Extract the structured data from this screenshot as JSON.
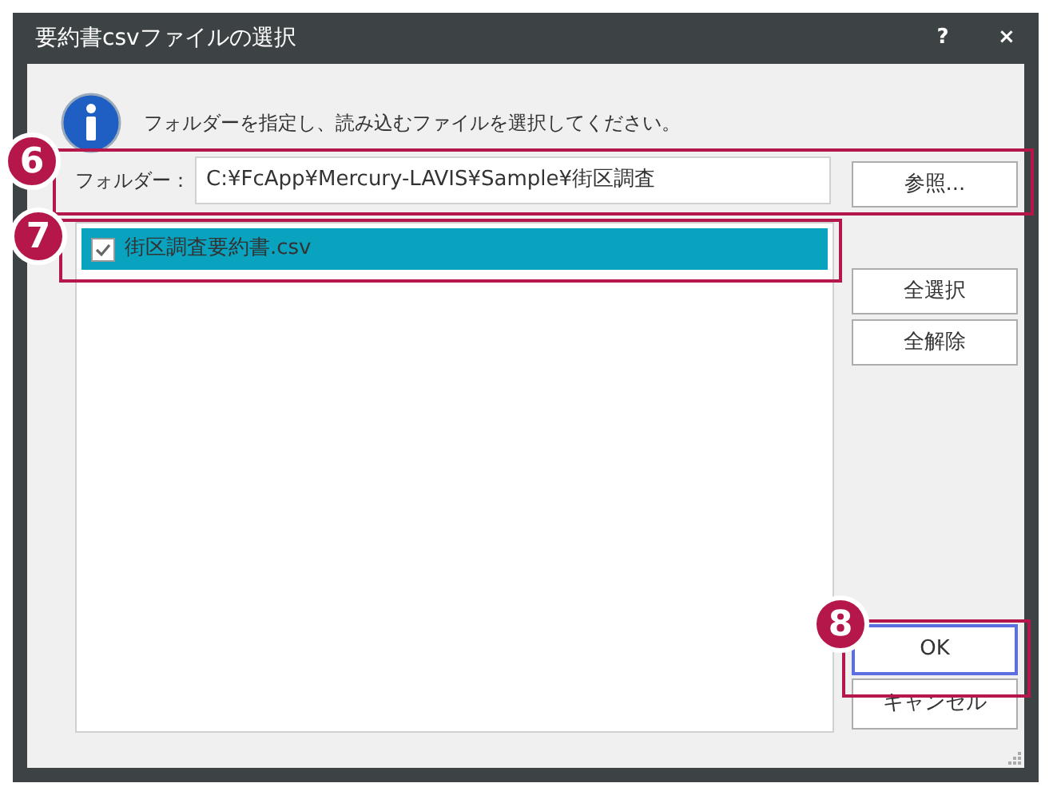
{
  "window": {
    "title": "要約書csvファイルの選択",
    "buttons": [
      "?",
      "×"
    ]
  },
  "message": "フォルダーを指定し、読み込むファイルを選択してください。",
  "folder": {
    "label": "フォルダー：",
    "value": "C:¥FcApp¥Mercury-LAVIS¥Sample¥街区調査"
  },
  "browse_button": "参照...",
  "files": [
    {
      "name": "街区調査要約書.csv",
      "checked": true,
      "selected": true
    }
  ],
  "side_buttons": [
    "全選択",
    "全解除"
  ],
  "ok_button": {
    "label": "OK",
    "focused": true
  },
  "cancel_button": "キャンセル",
  "callouts": [
    {
      "number": "6"
    },
    {
      "number": "7"
    },
    {
      "number": "8"
    }
  ]
}
